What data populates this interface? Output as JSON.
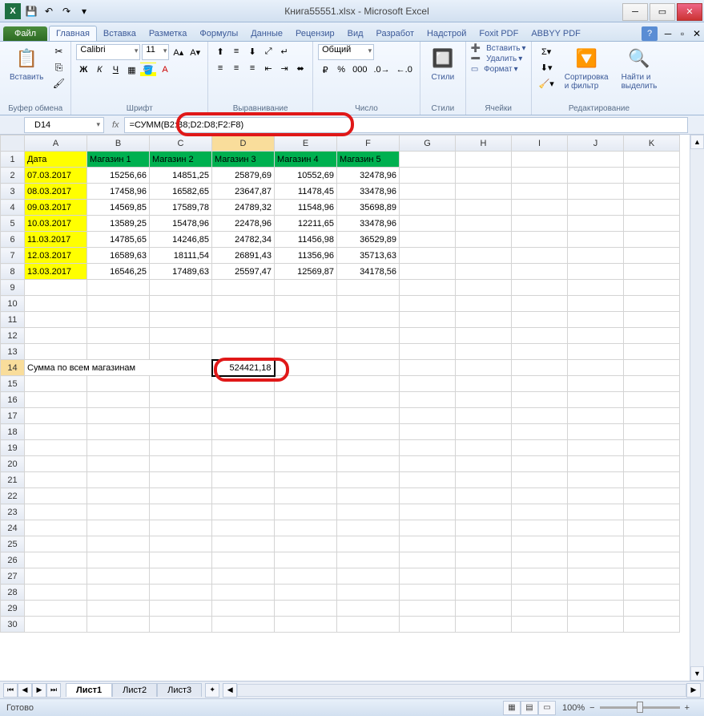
{
  "window": {
    "title": "Книга55551.xlsx - Microsoft Excel"
  },
  "qat": {
    "save": "💾",
    "undo": "↶",
    "redo": "↷"
  },
  "tabs": {
    "file": "Файл",
    "items": [
      "Главная",
      "Вставка",
      "Разметка",
      "Формулы",
      "Данные",
      "Рецензир",
      "Вид",
      "Разработ",
      "Надстрой",
      "Foxit PDF",
      "ABBYY PDF"
    ],
    "active": 0
  },
  "ribbon": {
    "clipboard": {
      "label": "Буфер обмена",
      "paste": "Вставить"
    },
    "font": {
      "label": "Шрифт",
      "name": "Calibri",
      "size": "11",
      "bold": "Ж",
      "italic": "К",
      "underline": "Ч"
    },
    "alignment": {
      "label": "Выравнивание"
    },
    "number": {
      "label": "Число",
      "format": "Общий"
    },
    "styles": {
      "label": "Стили",
      "btn": "Стили"
    },
    "cells": {
      "label": "Ячейки",
      "insert": "Вставить",
      "delete": "Удалить",
      "format": "Формат"
    },
    "editing": {
      "label": "Редактирование",
      "sort": "Сортировка\nи фильтр",
      "find": "Найти и\nвыделить"
    }
  },
  "namebox": "D14",
  "formula": "=СУММ(B2:B8;D2:D8;F2:F8)",
  "columns": [
    "A",
    "B",
    "C",
    "D",
    "E",
    "F",
    "G",
    "H",
    "I",
    "J",
    "K"
  ],
  "headers": [
    "Дата",
    "Магазин 1",
    "Магазин 2",
    "Магазин 3",
    "Магазин 4",
    "Магазин 5"
  ],
  "rows": [
    {
      "date": "07.03.2017",
      "v": [
        "15256,66",
        "14851,25",
        "25879,69",
        "10552,69",
        "32478,96"
      ]
    },
    {
      "date": "08.03.2017",
      "v": [
        "17458,96",
        "16582,65",
        "23647,87",
        "11478,45",
        "33478,96"
      ]
    },
    {
      "date": "09.03.2017",
      "v": [
        "14569,85",
        "17589,78",
        "24789,32",
        "11548,96",
        "35698,89"
      ]
    },
    {
      "date": "10.03.2017",
      "v": [
        "13589,25",
        "15478,96",
        "22478,96",
        "12211,65",
        "33478,96"
      ]
    },
    {
      "date": "11.03.2017",
      "v": [
        "14785,65",
        "14246,85",
        "24782,34",
        "11456,98",
        "36529,89"
      ]
    },
    {
      "date": "12.03.2017",
      "v": [
        "16589,63",
        "18111,54",
        "26891,43",
        "11356,96",
        "35713,63"
      ]
    },
    {
      "date": "13.03.2017",
      "v": [
        "16546,25",
        "17489,63",
        "25597,47",
        "12569,87",
        "34178,56"
      ]
    }
  ],
  "sum_label": "Сумма по всем магазинам",
  "sum_value": "524421,18",
  "sheets": [
    "Лист1",
    "Лист2",
    "Лист3"
  ],
  "active_sheet": 0,
  "status": "Готово",
  "zoom": "100%"
}
